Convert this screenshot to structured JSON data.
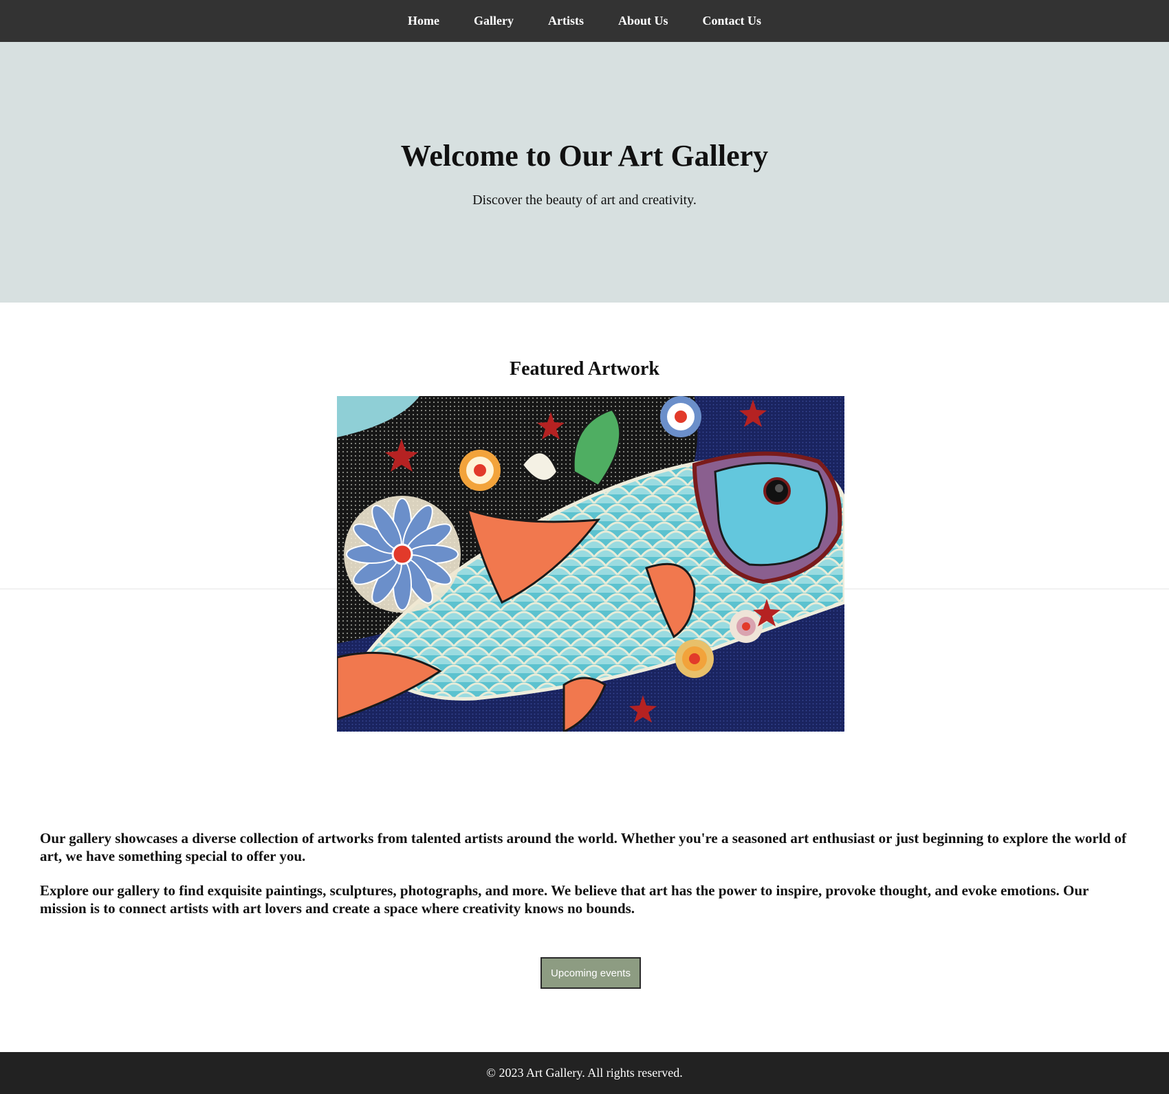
{
  "nav": {
    "items": [
      "Home",
      "Gallery",
      "Artists",
      "About Us",
      "Contact Us"
    ]
  },
  "hero": {
    "title": "Welcome to Our Art Gallery",
    "subtitle": "Discover the beauty of art and creativity."
  },
  "featured": {
    "title": "Featured Artwork"
  },
  "about": {
    "paragraphs": [
      "Our gallery showcases a diverse collection of artworks from talented artists around the world. Whether you're a seasoned art enthusiast or just beginning to explore the world of art, we have something special to offer you.",
      "Explore our gallery to find exquisite paintings, sculptures, photographs, and more. We believe that art has the power to inspire, provoke thought, and evoke emotions. Our mission is to connect artists with art lovers and create a space where creativity knows no bounds."
    ]
  },
  "cta": {
    "label": "Upcoming events"
  },
  "footer": {
    "text": "© 2023 Art Gallery. All rights reserved."
  },
  "colors": {
    "nav_bg": "#333333",
    "hero_bg": "#d7e0e0",
    "button_bg": "#8d9c82",
    "footer_bg": "#222222"
  }
}
